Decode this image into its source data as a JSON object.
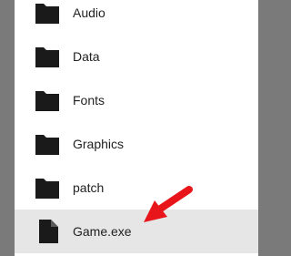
{
  "file_list": {
    "items": [
      {
        "label": "Audio",
        "icon": "folder-icon",
        "type": "folder"
      },
      {
        "label": "Data",
        "icon": "folder-icon",
        "type": "folder"
      },
      {
        "label": "Fonts",
        "icon": "folder-icon",
        "type": "folder"
      },
      {
        "label": "Graphics",
        "icon": "folder-icon",
        "type": "folder"
      },
      {
        "label": "patch",
        "icon": "folder-icon",
        "type": "folder"
      },
      {
        "label": "Game.exe",
        "icon": "file-icon",
        "type": "file",
        "selected": true
      }
    ]
  },
  "annotation": {
    "icon": "arrow-icon",
    "color": "#e8161b"
  },
  "colors": {
    "backdrop": "#7a7a7a",
    "panel": "#ffffff",
    "selected_row": "#e6e6e6",
    "icon": "#1a1a1a"
  }
}
